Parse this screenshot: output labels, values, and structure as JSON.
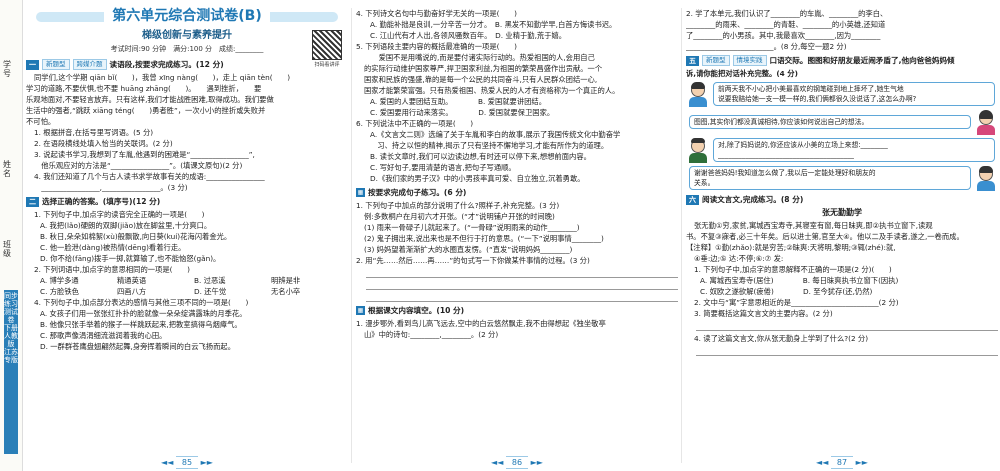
{
  "sidebar": {
    "labels": [
      "学号",
      "姓名",
      "班级"
    ],
    "series": "同步练习测试卷 下册 人教版 江苏专版"
  },
  "page1": {
    "title": "第六单元综合测试卷(B)",
    "subtitle": "梯级创新与素养提升",
    "qr_caption": "扫码看讲评",
    "info": "考试时间:90 分钟　满分:100 分　成绩:________",
    "s1_badge": "一",
    "s1_tag": "新题型",
    "s1_tag2": "跨媒介题",
    "s1_title": "读语段,按要求完成练习。(12 分)",
    "s1_lines": [
      "同学们,这个学期 qiān bǐ(　　)，我曾 xīng nàng(　　)，走上 qiān tèn(　　)",
      "学习的道路,不要伏惧,也不要 huāng zhāng(　　)。　　遇到挫折，　　要",
      "乐观地面对,不要轻言放弃。只有这样,我们才能战胜困难,取得成功。我们要做",
      "生活中的强者,“跳跃 xiāng téng(　　)勇者胜”，一次小小的挫折或失败并",
      "不可怕。"
    ],
    "s1_qs": [
      "1. 根据拼音,在括号里写词语。(5 分)",
      "2. 在语段横线处填入恰当的关联词。(2 分)",
      "3. 说起读书学习,我想到了车胤,他遇到的困难是“________________”,",
      "　他乐观应对的方法是“________________”。(填课文原句)(2 分)",
      "4. 我们还知道了几个与古人读书求学故事有关的成语:________________",
      "　________________,________________。(3 分)"
    ],
    "s2_badge": "二",
    "s2_title": "选择正确的答案。(填序号)(12 分)",
    "s2_qs": [
      "1. 下列句子中,加点字的读音完全正确的一项是(　　)",
      "A. 我把(lǎo)硬朗的双脚(jiǎo)放在脚盆里,十分爽口。",
      "B. 秋日,朵朵如棉絮(xù)般飘散,向日葵(kuí)花海闪着金光。",
      "C. 他一脸泄(dàng)被热情(dēng)看着行走。",
      "D. 你不给(fāng)拨手一掷,就算输了,也不能恼怒(gǎn)。",
      "2. 下列词语中,加点字的意思相同的一项是(　　)",
      "3. 下列词语中,加点字的意思相同的一项是(　　)",
      "4. 下列句子中,加点部分表达的感情与其他三项不同的一项是(　　)",
      "A. 女孩子们用一张张红扑扑的脸就像一朵朵绽满露珠的月季花。",
      "B. 他像只张手举着的猴子一样跳跃起来,把教室搞得乌烟瘴气。",
      "C. 那歌声像涓涓细流滋润着我的心田。",
      "D. 一群群苍鹰盘翅翩然起舞,身旁挥着瞬间的白云飞扬而起。"
    ],
    "s2_opts_a": [
      "A. 博学多通",
      "精通英语",
      "B. 过恶溪",
      "明辨是非"
    ],
    "s2_opts_b": [
      "C. 方脸铁色",
      "四画八方",
      "D. 还午觉",
      "无名小卒"
    ],
    "page_no": "85"
  },
  "page2": {
    "qs_top": [
      "4. 下列诗文名句中与勤奋好学无关的一项是(　　)",
      "A. 勤能补拙是良训,一分辛苦一分才。　B. 黑发不知勤学早,白首方悔读书迟。",
      "C. 江山代有才人出,各领风骚数百年。　D. 业精于勤,荒于嬉。",
      "5. 下列语段主要内容的概括最准确的一项是(　　)",
      "　　爱国不是用嘴说的,而是要付诸实际行动的。热爱祖国的人,会用自己",
      "的实际行动维护国家尊严,捍卫国家利益,为祖国的繁荣昌盛作出贡献。一个",
      "国家和民族的强盛,靠的是每一个公民的共同奋斗,只有人民群众团结一心,",
      "国家才能繁荣富强。只有热爱祖国、热爱人民的人才有资格称为一个真正的人。",
      "A. 爱国的人要团结互助。　　　　B. 爱国就要讲团结。",
      "C. 爱国要用行动来落实。　　　　D. 爱国就要保卫国家。",
      "6. 下列说法中不正确的一项是(　　)",
      "A.《文言文二则》选编了关于车胤和李白的故事,展示了我国传统文化中勤奋学",
      "　习、持之以恒的精神,揭示了只有坚持不懈地学习,才能有所作为的道理。",
      "B. 读长文章时,我们可以边读边想,有时还可以停下来,想想前面内容。",
      "C. 写好句子,要用清楚的语言,把句子写通顺。",
      "D.《我们家的男子汉》中的小男孩率真可爱、自立独立,沉着勇敢。"
    ],
    "s3_title": "按要求完成句子练习。(6 分)",
    "s3_lines": [
      "1. 下列句子中加点的部分说明了什么?照样子,补充完整。(3 分)",
      "例:多数桐户在月初六才开张。(“才”说明铺户开张的时间晚)",
      "(1) 雨来一骨碌子儿就起来了。(“一骨碌”说明雨来的动作________)",
      "(2) 鬼子拥出来,说出来也是不但行于打的意思。(“一下”说明事情________)",
      "(3) 妈妈望着渐渐扩大的水圈直发愣。(“直发”说明妈妈________)",
      "2. 用“先……然后……再……”的句式写一下你做某件事情的过程。(3 分)"
    ],
    "s4_title": "根据课文内容填空。(10 分)",
    "s4_lines": [
      "1. 漫步鄂外,看到鸟儿高飞远去,空中的白云悠然飘走,我不由得想起《独坐敬亭",
      "山》中的诗句:________,________。(2 分)"
    ],
    "page_no": "86"
  },
  "page3": {
    "top_lines": [
      "2. 学了本单元,我们认识了________的车胤、________的李白、",
      "________的雨来、________的青鞋、________的小英雄,还知道",
      "了________的小男孩。其中,我最喜欢________,因为________",
      "________________________。(8 分,每空一题2 分)"
    ],
    "s5_badge": "五",
    "s5_tag": "新题型",
    "s5_tag2": "情境实践",
    "s5_title": "口语交际。图图和好朋友最近闹矛盾了,他向爸爸妈妈倾",
    "s5_title2": "诉,请你能把对话补充完整。(4 分)",
    "dialog": [
      "前两天我不小心把小美最喜欢的钢笔碰到地上摔坏了,她生气地",
      "说要我赔给她一支一模一样的,我们俩都很久没说话了,这怎么办啊?",
      "图图,其实你们都没真诚相待,你应该如何说出自己的想法。",
      "对,除了妈妈说的,你还应该从小美的立场上来想:________",
      "________________________________________",
      "谢谢爸爸妈妈!我知道怎么做了,我以后一定能处理好和朋友的",
      "关系。"
    ],
    "s6_badge": "六",
    "s6_title": "阅读文言文,完成练习。(8 分)",
    "passage_title": "张无勤勤学",
    "passage": [
      "张无勤①穷,家贫,寓城西宝寿寺,其寝室有窗,每日昧爽,即②执书立窗下,读观",
      "书。不复③寐者,必三十年矣。后以进士第,官至大④。他以二及手读者,遂之,一卷而成。"
    ],
    "note": "【注释】①勤(zhǎo):就是穷苦;②昧爽:天将明,黎明;③辄(zhé):就,",
    "note2": "④垂:边;⑤ 达:不停;⑥:⑦ 发:",
    "q_lines": [
      "1. 下列句子中,加点字的意思解释不正确的一项是(2 分)(　　)",
      "A. 寓城西宝寿寺(居住)　　　　B. 每日昧爽执书立窗下(因执)",
      "C. 奴欧之遂欲解(疲倦)　　　　D. 至今犹存(还,仍然)",
      "2. 文中与“寓”字意思相近的是________________________(2 分)",
      "3. 简要概括这篇文言文的主要内容。(2 分)",
      "4. 读了这篇文言文,你从张无勤身上学到了什么?(2 分)"
    ],
    "page_no": "87"
  }
}
